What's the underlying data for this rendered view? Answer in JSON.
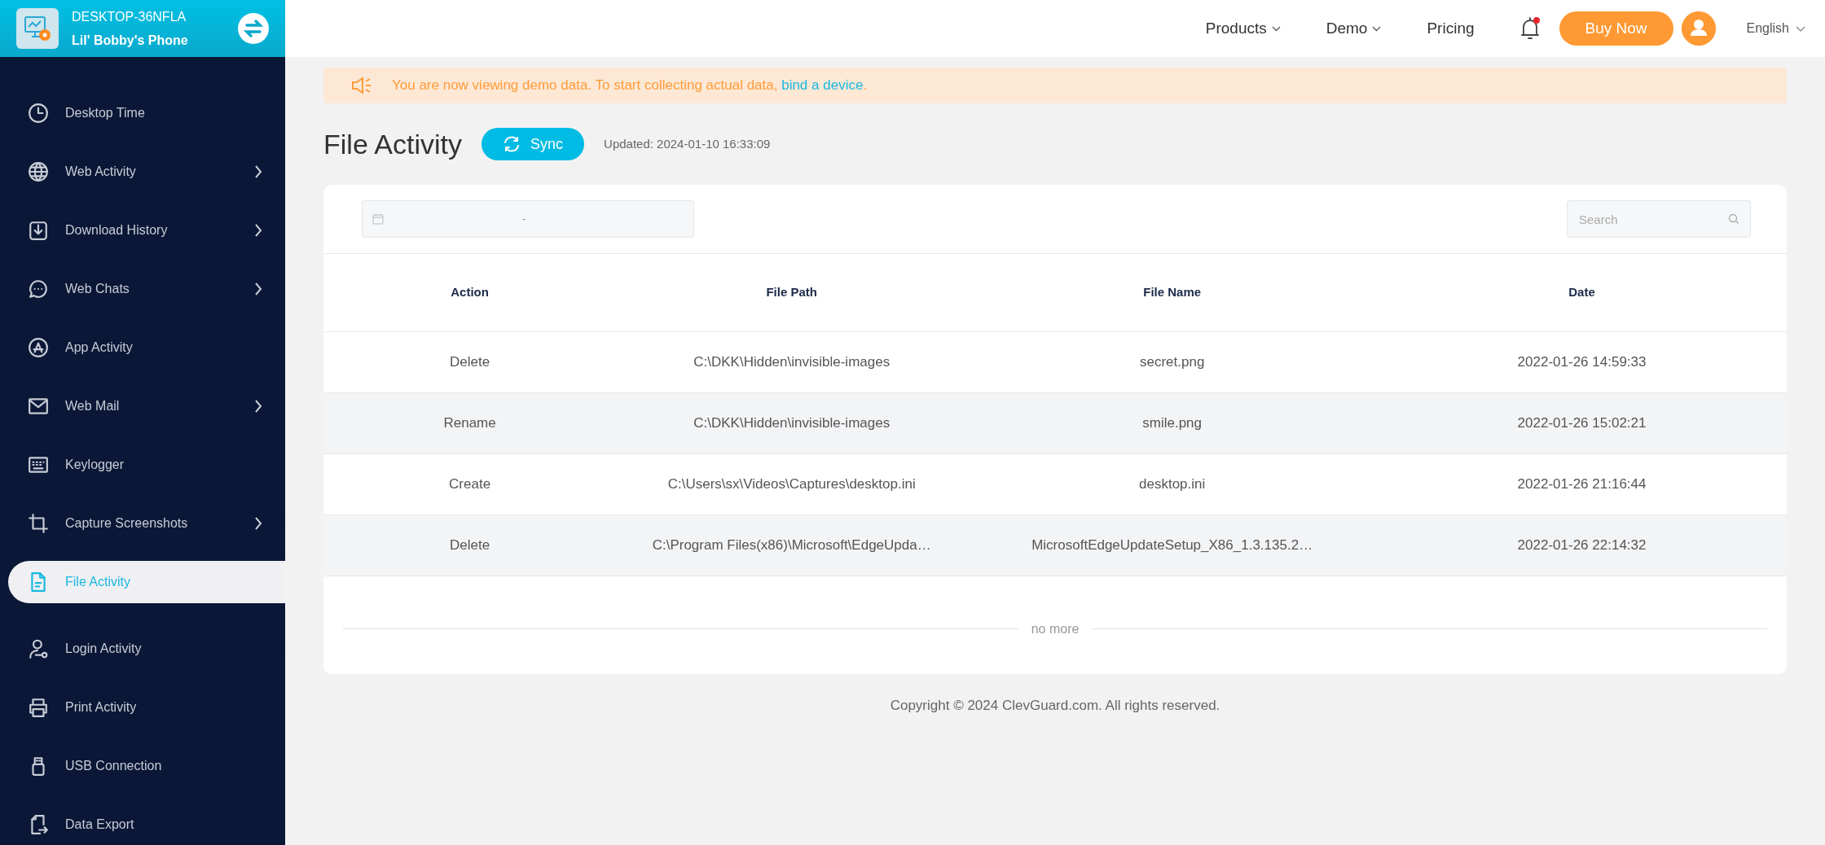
{
  "device": {
    "name": "DESKTOP-36NFLA",
    "label": "Lil' Bobby's Phone"
  },
  "sidebar": {
    "items": [
      {
        "label": "Desktop Time",
        "submenu": false,
        "selected": false
      },
      {
        "label": "Web Activity",
        "submenu": true,
        "selected": false
      },
      {
        "label": "Download History",
        "submenu": true,
        "selected": false
      },
      {
        "label": "Web Chats",
        "submenu": true,
        "selected": false
      },
      {
        "label": "App Activity",
        "submenu": false,
        "selected": false
      },
      {
        "label": "Web Mail",
        "submenu": true,
        "selected": false
      },
      {
        "label": "Keylogger",
        "submenu": false,
        "selected": false
      },
      {
        "label": "Capture Screenshots",
        "submenu": true,
        "selected": false
      },
      {
        "label": "File Activity",
        "submenu": false,
        "selected": true
      },
      {
        "label": "Login Activity",
        "submenu": false,
        "selected": false
      },
      {
        "label": "Print Activity",
        "submenu": false,
        "selected": false
      },
      {
        "label": "USB Connection",
        "submenu": false,
        "selected": false
      },
      {
        "label": "Data Export",
        "submenu": false,
        "selected": false
      }
    ]
  },
  "nav": {
    "links": [
      {
        "label": "Products",
        "dropdown": true
      },
      {
        "label": "Demo",
        "dropdown": true
      },
      {
        "label": "Pricing",
        "dropdown": false
      }
    ],
    "notification": true,
    "buy_button": "Buy Now",
    "language": "English"
  },
  "banner": {
    "text": "You are now viewing demo data. To start collecting actual data, ",
    "link": "bind a device",
    "end": "."
  },
  "page": {
    "title": "File Activity",
    "sync_button": "Sync",
    "updated": "Updated: 2024-01-10 16:33:09"
  },
  "filter": {
    "date_separator": "-",
    "search_placeholder": "Search"
  },
  "table": {
    "columns": [
      "Action",
      "File Path",
      "File Name",
      "Date"
    ],
    "rows": [
      [
        "Delete",
        "C:\\DKK\\Hidden\\invisible-images",
        "secret.png",
        "2022-01-26 14:59:33"
      ],
      [
        "Rename",
        "C:\\DKK\\Hidden\\invisible-images",
        "smile.png",
        "2022-01-26 15:02:21"
      ],
      [
        "Create",
        "C:\\Users\\sx\\Videos\\Captures\\desktop.ini",
        "desktop.ini",
        "2022-01-26 21:16:44"
      ],
      [
        "Delete",
        "C:\\Program Files(x86)\\Microsoft\\EdgeUpda…",
        "MicrosoftEdgeUpdateSetup_X86_1.3.135.2…",
        "2022-01-26 22:14:32"
      ]
    ],
    "end_note": "no more"
  },
  "copyright": "Copyright © 2024 ClevGuard.com. All rights reserved."
}
